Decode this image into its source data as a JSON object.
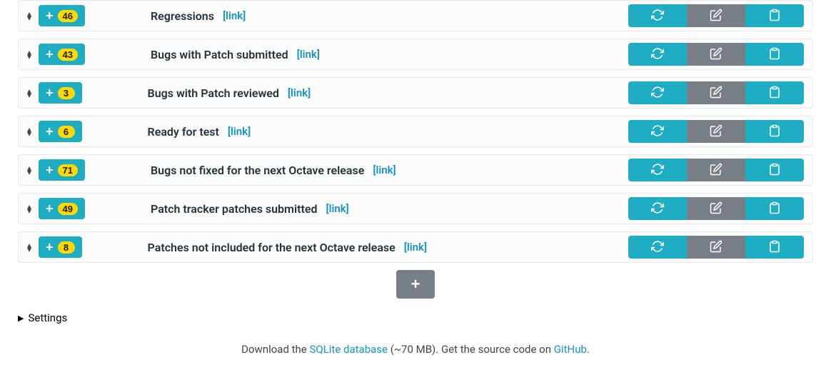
{
  "rows": [
    {
      "count": "46",
      "title": "Regressions",
      "link": "[link]"
    },
    {
      "count": "43",
      "title": "Bugs with Patch submitted",
      "link": "[link]"
    },
    {
      "count": "3",
      "title": "Bugs with Patch reviewed",
      "link": "[link]"
    },
    {
      "count": "6",
      "title": "Ready for test",
      "link": "[link]"
    },
    {
      "count": "71",
      "title": "Bugs not fixed for the next Octave release",
      "link": "[link]"
    },
    {
      "count": "49",
      "title": "Patch tracker patches submitted",
      "link": "[link]"
    },
    {
      "count": "8",
      "title": "Patches not included for the next Octave release",
      "link": "[link]"
    }
  ],
  "settings": {
    "label": "Settings"
  },
  "footer": {
    "download_pre": "Download the ",
    "db_link": "SQLite database",
    "db_size": " (~70 MB).   ",
    "source_pre": "Get the source code on ",
    "github": "GitHub",
    "period": "."
  }
}
